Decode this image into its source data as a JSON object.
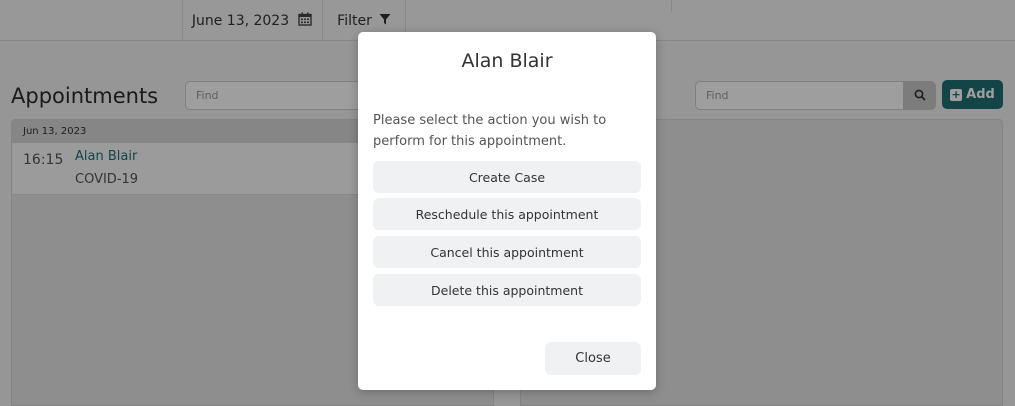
{
  "topbar": {
    "date": "June 13, 2023",
    "filter_label": "Filter"
  },
  "page": {
    "title": "Appointments",
    "left_find_placeholder": "Find",
    "right_find_placeholder": "Find",
    "add_label": "Add"
  },
  "appointments": {
    "day_label": "Jun 13, 2023",
    "items": [
      {
        "time": "16:15",
        "name": "Alan Blair",
        "type": "COVID-19"
      }
    ]
  },
  "modal": {
    "title": "Alan Blair",
    "message": "Please select the action you wish to perform for this appointment.",
    "actions": [
      {
        "label": "Create Case"
      },
      {
        "label": "Reschedule this appointment"
      },
      {
        "label": "Cancel this appointment"
      },
      {
        "label": "Delete this appointment"
      }
    ],
    "close_label": "Close"
  },
  "icons": {
    "calendar": "calendar-icon",
    "filter": "filter-icon",
    "search": "search-icon",
    "add": "plus-square-icon"
  },
  "colors": {
    "accent": "#1f6f74",
    "overlay": "rgba(0,0,0,0.38)"
  }
}
